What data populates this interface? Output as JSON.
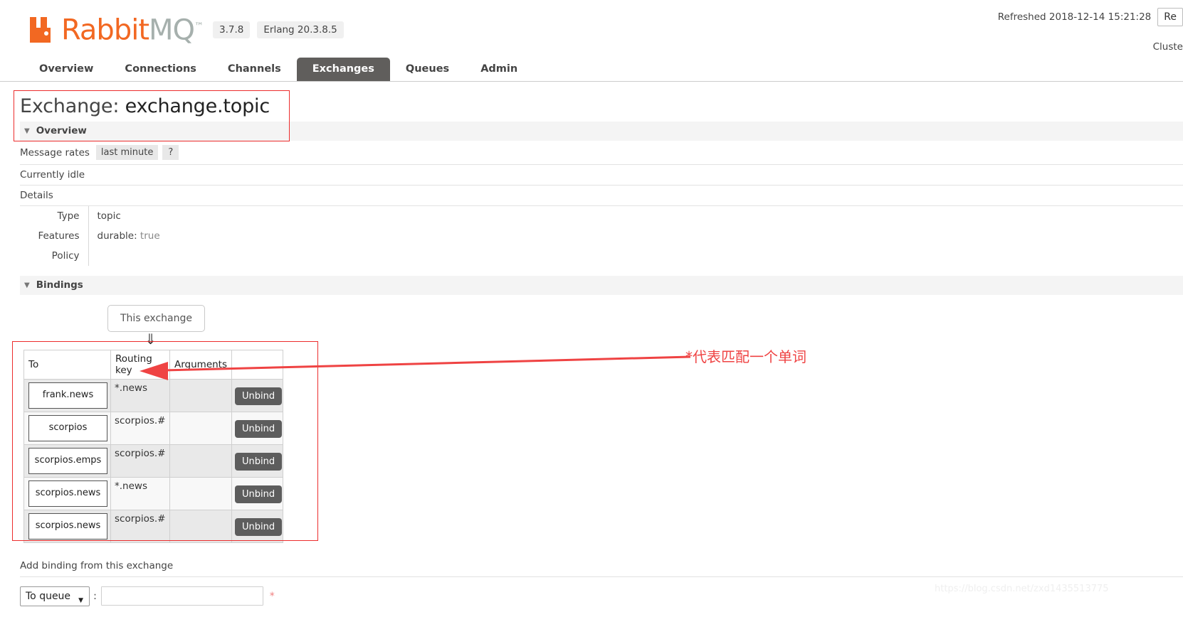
{
  "brand": {
    "name_part1": "Rabbit",
    "name_part2": "MQ",
    "tm": "™",
    "version": "3.7.8",
    "erlang": "Erlang 20.3.8.5",
    "orange": "#f26822",
    "grey": "#a6b0ad"
  },
  "header": {
    "refreshed_label": "Refreshed 2018-12-14 15:21:28",
    "refresh_button": "Re",
    "cluster_label": "Cluste"
  },
  "nav": {
    "items": [
      {
        "label": "Overview",
        "active": false
      },
      {
        "label": "Connections",
        "active": false
      },
      {
        "label": "Channels",
        "active": false
      },
      {
        "label": "Exchanges",
        "active": true
      },
      {
        "label": "Queues",
        "active": false
      },
      {
        "label": "Admin",
        "active": false
      }
    ]
  },
  "page": {
    "title_prefix": "Exchange: ",
    "exchange_name": "exchange.topic"
  },
  "overview": {
    "section_label": "Overview",
    "triangle": "▼",
    "message_rates_label": "Message rates",
    "message_rates_period": "last minute",
    "help": "?",
    "status": "Currently idle",
    "details_label": "Details",
    "details": [
      {
        "key": "Type",
        "value": "topic",
        "value_muted": ""
      },
      {
        "key": "Features",
        "value": "durable: ",
        "value_muted": "true"
      },
      {
        "key": "Policy",
        "value": "",
        "value_muted": ""
      }
    ]
  },
  "bindings": {
    "section_label": "Bindings",
    "triangle": "▼",
    "this_exchange_button": "This exchange",
    "down_arrow": "⇓",
    "columns": [
      "To",
      "Routing key",
      "Arguments",
      ""
    ],
    "rows": [
      {
        "to": "frank.news",
        "routing_key": "*.news",
        "arguments": "",
        "action": "Unbind"
      },
      {
        "to": "scorpios",
        "routing_key": "scorpios.#",
        "arguments": "",
        "action": "Unbind"
      },
      {
        "to": "scorpios.emps",
        "routing_key": "scorpios.#",
        "arguments": "",
        "action": "Unbind"
      },
      {
        "to": "scorpios.news",
        "routing_key": "*.news",
        "arguments": "",
        "action": "Unbind"
      },
      {
        "to": "scorpios.news",
        "routing_key": "scorpios.#",
        "arguments": "",
        "action": "Unbind"
      }
    ]
  },
  "annotation": {
    "text": "*代表匹配一个单词",
    "color": "#ef4343"
  },
  "add_binding": {
    "heading": "Add binding from this exchange",
    "destination_selected": "To queue",
    "caret": "▼",
    "colon": ":",
    "destination_value": "",
    "destination_placeholder": "",
    "required_mark": "*"
  },
  "watermark": {
    "text": "https://blog.csdn.net/zxd1435513775"
  }
}
